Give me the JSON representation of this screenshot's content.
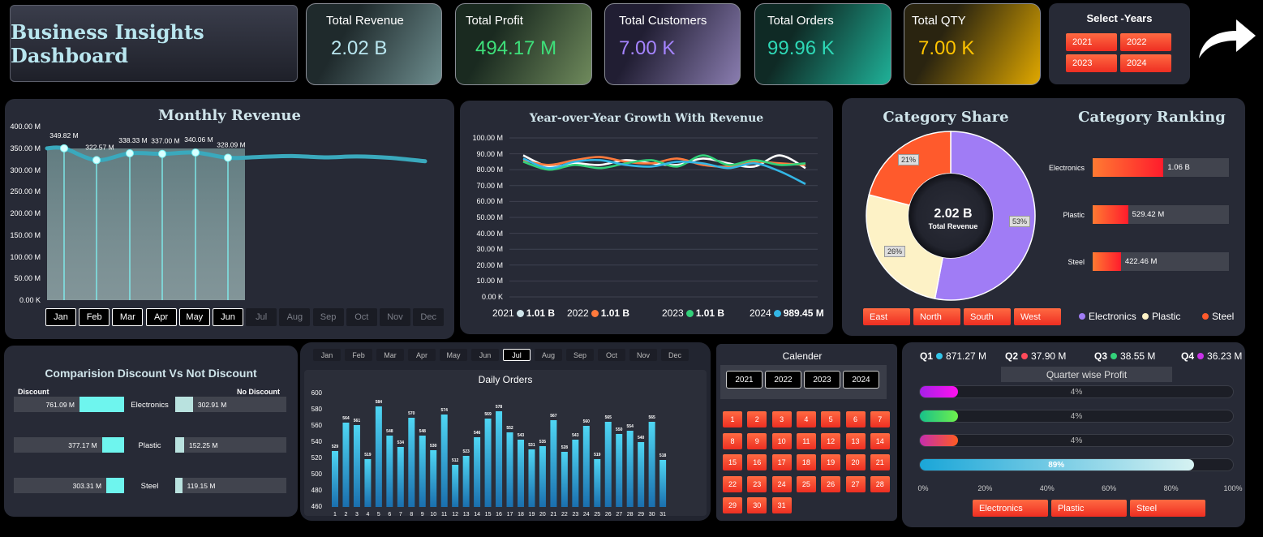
{
  "header": {
    "title": "Business Insights Dashboard"
  },
  "kpis": [
    {
      "label": "Total Revenue",
      "value": "2.02 B",
      "color": "#b9e6ef"
    },
    {
      "label": "Total Profit",
      "value": "494.17 M",
      "color": "#3ee07a"
    },
    {
      "label": "Total Customers",
      "value": "7.00 K",
      "color": "#a584ff"
    },
    {
      "label": "Total Orders",
      "value": "99.96 K",
      "color": "#2ed8b6"
    },
    {
      "label": "Total QTY",
      "value": "7.00 K",
      "color": "#ffc400"
    }
  ],
  "year_slicer": {
    "title": "Select -Years",
    "years": [
      "2021",
      "2022",
      "2023",
      "2024"
    ]
  },
  "months": [
    "Jan",
    "Feb",
    "Mar",
    "Apr",
    "May",
    "Jun",
    "Jul",
    "Aug",
    "Sep",
    "Oct",
    "Nov",
    "Dec"
  ],
  "monthly_revenue": {
    "chart_data": {
      "type": "line",
      "title": "Monthly Revenue",
      "yticks": [
        "400.00 M",
        "350.00 M",
        "300.00 M",
        "250.00 M",
        "200.00 M",
        "150.00 M",
        "100.00 M",
        "50.00 M",
        "0.00 K"
      ],
      "ylim": [
        0,
        400
      ],
      "selected_months": [
        "Jan",
        "Feb",
        "Mar",
        "Apr",
        "May",
        "Jun"
      ],
      "values": [
        349.82,
        322.57,
        338.33,
        337.0,
        340.06,
        328.09
      ],
      "labels": [
        "349.82 M",
        "322.57 M",
        "338.33 M",
        "337.00 M",
        "340.06 M",
        "328.09 M"
      ]
    }
  },
  "yoy": {
    "chart_data": {
      "type": "line",
      "title": "Year-over-Year Growth With Revenue",
      "yticks": [
        "100.00 M",
        "90.00 M",
        "80.00 M",
        "70.00 M",
        "60.00 M",
        "50.00 M",
        "40.00 M",
        "30.00 M",
        "20.00 M",
        "10.00 M",
        "0.00 K"
      ],
      "ylim": [
        0,
        100
      ],
      "series": [
        {
          "name": "2021",
          "color": "#ffffff",
          "values": [
            89,
            82,
            84,
            83,
            86,
            84,
            83,
            87,
            84,
            82,
            89,
            81
          ]
        },
        {
          "name": "2022",
          "color": "#ff7a3c",
          "values": [
            86,
            83,
            86,
            88,
            85,
            84,
            87,
            83,
            82,
            85,
            84,
            83
          ]
        },
        {
          "name": "2023",
          "color": "#33d17a",
          "values": [
            85,
            80,
            83,
            81,
            84,
            86,
            82,
            89,
            83,
            86,
            83,
            84
          ]
        },
        {
          "name": "2024",
          "color": "#33b6e5",
          "values": [
            87,
            81,
            85,
            86,
            83,
            82,
            85,
            84,
            81,
            84,
            79,
            71
          ]
        }
      ],
      "legend": [
        {
          "year": "2021",
          "value": "1.01 B",
          "color": "#cfe4ea"
        },
        {
          "year": "2022",
          "value": "1.01 B",
          "color": "#ff7a3c"
        },
        {
          "year": "2023",
          "value": "1.01 B",
          "color": "#33d17a"
        },
        {
          "year": "2024",
          "value": "989.45 M",
          "color": "#33b6e5"
        }
      ]
    }
  },
  "category_share": {
    "chart_data": {
      "type": "pie",
      "title": "Category Share",
      "center_value": "2.02 B",
      "center_label": "Total Revenue",
      "slices": [
        {
          "name": "Electronics",
          "value": 53,
          "label": "53%",
          "color": "#a07cf5"
        },
        {
          "name": "Plastic",
          "value": 26,
          "label": "26%",
          "color": "#fdf2c6"
        },
        {
          "name": "Steel",
          "value": 21,
          "label": "21%",
          "color": "#ff5a2c"
        }
      ]
    },
    "regions": [
      "East",
      "North",
      "South",
      "West"
    ],
    "legend": [
      "Electronics",
      "Plastic",
      "Steel"
    ]
  },
  "category_ranking": {
    "chart_data": {
      "type": "bar",
      "title": "Category Ranking",
      "categories": [
        "Electronics",
        "Plastic",
        "Steel"
      ],
      "values": [
        1060,
        529.42,
        422.46
      ],
      "labels": [
        "1.06 B",
        "529.42 M",
        "422.46 M"
      ],
      "max": 1060
    }
  },
  "discount": {
    "chart_data": {
      "type": "bar",
      "title": "Comparision Discount Vs Not Discount",
      "left_header": "Discount",
      "right_header": "No Discount",
      "categories": [
        "Electronics",
        "Plastic",
        "Steel"
      ],
      "discount_values": [
        761.09,
        377.17,
        303.31
      ],
      "discount_labels": [
        "761.09 M",
        "377.17 M",
        "303.31 M"
      ],
      "nodiscount_values": [
        302.91,
        152.25,
        119.15
      ],
      "nodiscount_labels": [
        "302.91 M",
        "152.25 M",
        "119.15 M"
      ],
      "max": 761.09
    }
  },
  "daily_orders": {
    "selected_month": "Jul",
    "chart_data": {
      "type": "bar",
      "title": "Daily Orders",
      "ylim": [
        460,
        600
      ],
      "yticks": [
        "600",
        "580",
        "560",
        "540",
        "520",
        "500",
        "480",
        "460"
      ],
      "categories": [
        "1",
        "2",
        "3",
        "4",
        "5",
        "6",
        "7",
        "8",
        "9",
        "10",
        "11",
        "12",
        "13",
        "14",
        "15",
        "16",
        "17",
        "18",
        "19",
        "20",
        "21",
        "22",
        "23",
        "24",
        "25",
        "26",
        "27",
        "28",
        "29",
        "30",
        "31"
      ],
      "values": [
        529,
        564,
        561,
        519,
        584,
        548,
        534,
        570,
        548,
        530,
        574,
        512,
        523,
        546,
        569,
        578,
        552,
        543,
        531,
        535,
        567,
        528,
        543,
        560,
        519,
        565,
        550,
        554,
        540,
        565,
        518
      ]
    }
  },
  "calendar": {
    "title": "Calender",
    "years": [
      "2021",
      "2022",
      "2023",
      "2024"
    ],
    "days": [
      "1",
      "2",
      "3",
      "4",
      "5",
      "6",
      "7",
      "8",
      "9",
      "10",
      "11",
      "12",
      "13",
      "14",
      "15",
      "16",
      "17",
      "18",
      "19",
      "20",
      "21",
      "22",
      "23",
      "24",
      "25",
      "26",
      "27",
      "28",
      "29",
      "30",
      "31"
    ]
  },
  "quarters": {
    "items": [
      {
        "label": "Q1",
        "value": "871.27 M",
        "color": "#33c6ea"
      },
      {
        "label": "Q2",
        "value": "37.90 M",
        "color": "#ff4a5a"
      },
      {
        "label": "Q3",
        "value": "38.55 M",
        "color": "#33d17a"
      },
      {
        "label": "Q4",
        "value": "36.23 M",
        "color": "#c832e8"
      }
    ],
    "chart_data": {
      "type": "bar",
      "title": "Quarter wise Profit",
      "values": [
        4,
        4,
        4,
        89
      ],
      "labels": [
        "4%",
        "4%",
        "4%",
        "89%"
      ],
      "xticks": [
        "0%",
        "20%",
        "40%",
        "60%",
        "80%",
        "100%"
      ]
    },
    "categories": [
      "Electronics",
      "Plastic",
      "Steel"
    ]
  }
}
